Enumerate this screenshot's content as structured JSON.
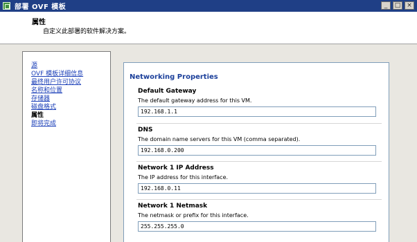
{
  "window": {
    "title": "部署 OVF 模板",
    "controls": {
      "minimize": "_",
      "maximize": "□",
      "close": "×"
    }
  },
  "header": {
    "title": "属性",
    "subtitle": "自定义此部署的软件解决方案。"
  },
  "nav": {
    "items": [
      {
        "label": "源",
        "current": false
      },
      {
        "label": "OVF 模板详细信息",
        "current": false
      },
      {
        "label": "最终用户许可协议",
        "current": false
      },
      {
        "label": "名称和位置",
        "current": false
      },
      {
        "label": "存储器",
        "current": false
      },
      {
        "label": "磁盘格式",
        "current": false
      },
      {
        "label": "属性",
        "current": true
      },
      {
        "label": "即将完成",
        "current": false
      }
    ]
  },
  "content": {
    "section_title": "Networking Properties",
    "fields": [
      {
        "label": "Default Gateway",
        "description": "The default gateway address for this VM.",
        "value": "192.168.1.1"
      },
      {
        "label": "DNS",
        "description": "The domain name servers for this VM (comma separated).",
        "value": "192.168.0.200"
      },
      {
        "label": "Network 1 IP Address",
        "description": "The IP address for this interface.",
        "value": "192.168.0.11"
      },
      {
        "label": "Network 1 Netmask",
        "description": "The netmask or prefix for this interface.",
        "value": "255.255.255.0"
      }
    ]
  }
}
